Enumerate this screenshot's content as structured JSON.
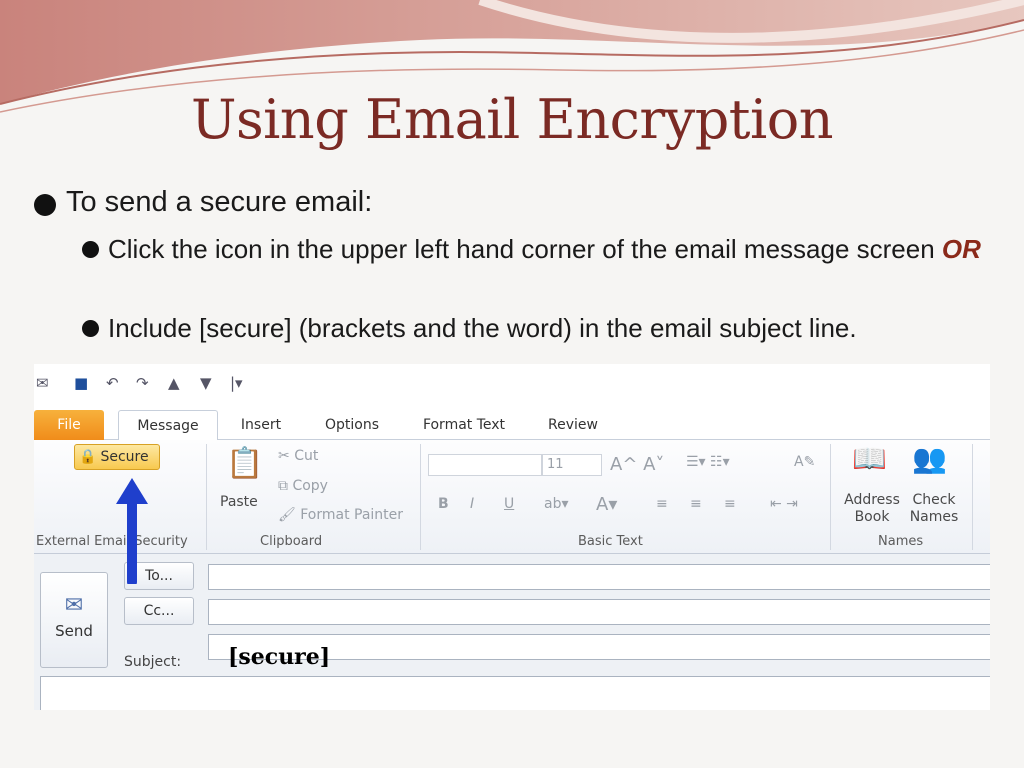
{
  "slide": {
    "title": "Using Email Encryption",
    "bullet1": "To send a secure email:",
    "sub1_text": "Click the icon in the upper left hand corner of the email message screen ",
    "sub1_or": "OR",
    "sub2_text": "Include [secure] (brackets and the word) in the email subject line."
  },
  "colors": {
    "title": "#7b2a24",
    "accent_or": "#8b2a1a",
    "arrow": "#1f3fcc",
    "file_tab": "#f08c1a"
  },
  "outlook": {
    "tabs": [
      "File",
      "Message",
      "Insert",
      "Options",
      "Format Text",
      "Review"
    ],
    "active_tab": "Message",
    "ribbon": {
      "secure_label": "Secure",
      "ext_security_group": "External Email Security",
      "paste_label": "Paste",
      "cut_label": "Cut",
      "copy_label": "Copy",
      "format_painter_label": "Format Painter",
      "clipboard_group": "Clipboard",
      "font_size": "11",
      "basic_text_group": "Basic Text",
      "address_book_label": "Address Book",
      "check_names_label": "Check Names",
      "names_group": "Names"
    },
    "compose": {
      "send_label": "Send",
      "to_label": "To...",
      "cc_label": "Cc...",
      "subject_label": "Subject:",
      "subject_value": "[secure]"
    }
  }
}
